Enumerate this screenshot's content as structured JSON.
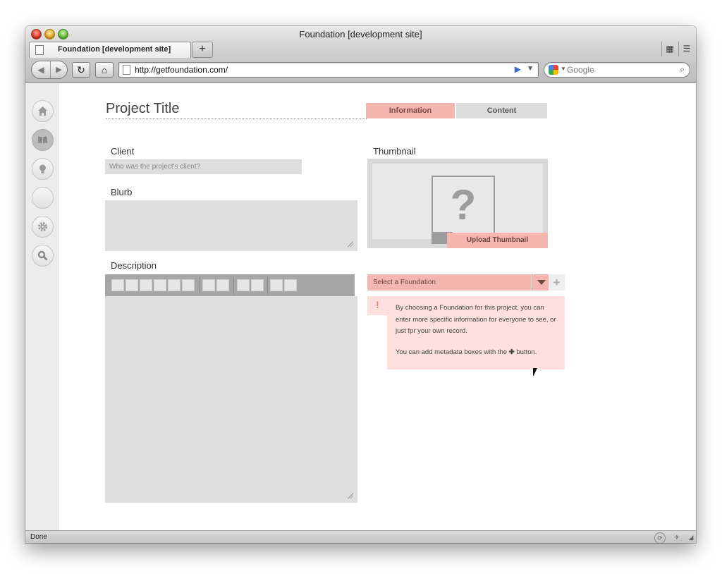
{
  "window": {
    "title": "Foundation [development site]",
    "tab_title": "Foundation [development site]",
    "new_tab_label": "+",
    "url": "http://getfoundation.com/",
    "search_placeholder": "Google",
    "status": "Done"
  },
  "page": {
    "project_title": "Project Title",
    "tabs": [
      {
        "label": "Information",
        "active": true
      },
      {
        "label": "Content",
        "active": false
      }
    ],
    "fields": {
      "client_label": "Client",
      "client_placeholder": "Who was the project's client?",
      "blurb_label": "Blurb",
      "description_label": "Description",
      "thumbnail_label": "Thumbnail"
    },
    "thumbnail": {
      "placeholder_glyph": "?",
      "upload_label": "Upload Thumbnail"
    },
    "foundation": {
      "select_label": "Select a Foundation",
      "add_label": "+",
      "notice_mark": "!",
      "notice_line1": "By choosing a Foundation for this project, you can enter more specific information for everyone to see, or just fpr your own record.",
      "notice_line2_before": "You can add metadata boxes with the",
      "notice_line2_plus": "✚",
      "notice_line2_after": "button."
    }
  },
  "colors": {
    "accent": "#f4b6ae",
    "notice_bg": "#fde0dd",
    "field_bg": "#dedede",
    "toolbar": "#a6a6a6"
  },
  "sidebar_icons": [
    "home-icon",
    "book-icon",
    "lightbulb-icon",
    "blank-icon",
    "gear-icon",
    "search-icon"
  ]
}
